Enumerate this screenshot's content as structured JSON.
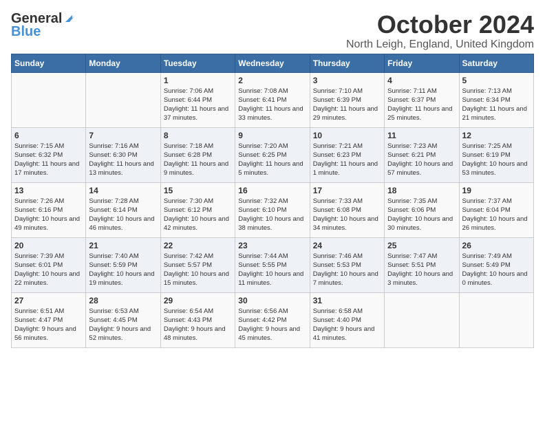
{
  "header": {
    "logo_general": "General",
    "logo_blue": "Blue",
    "month_title": "October 2024",
    "location": "North Leigh, England, United Kingdom"
  },
  "days_of_week": [
    "Sunday",
    "Monday",
    "Tuesday",
    "Wednesday",
    "Thursday",
    "Friday",
    "Saturday"
  ],
  "weeks": [
    [
      {
        "day": "",
        "detail": ""
      },
      {
        "day": "",
        "detail": ""
      },
      {
        "day": "1",
        "detail": "Sunrise: 7:06 AM\nSunset: 6:44 PM\nDaylight: 11 hours and 37 minutes."
      },
      {
        "day": "2",
        "detail": "Sunrise: 7:08 AM\nSunset: 6:41 PM\nDaylight: 11 hours and 33 minutes."
      },
      {
        "day": "3",
        "detail": "Sunrise: 7:10 AM\nSunset: 6:39 PM\nDaylight: 11 hours and 29 minutes."
      },
      {
        "day": "4",
        "detail": "Sunrise: 7:11 AM\nSunset: 6:37 PM\nDaylight: 11 hours and 25 minutes."
      },
      {
        "day": "5",
        "detail": "Sunrise: 7:13 AM\nSunset: 6:34 PM\nDaylight: 11 hours and 21 minutes."
      }
    ],
    [
      {
        "day": "6",
        "detail": "Sunrise: 7:15 AM\nSunset: 6:32 PM\nDaylight: 11 hours and 17 minutes."
      },
      {
        "day": "7",
        "detail": "Sunrise: 7:16 AM\nSunset: 6:30 PM\nDaylight: 11 hours and 13 minutes."
      },
      {
        "day": "8",
        "detail": "Sunrise: 7:18 AM\nSunset: 6:28 PM\nDaylight: 11 hours and 9 minutes."
      },
      {
        "day": "9",
        "detail": "Sunrise: 7:20 AM\nSunset: 6:25 PM\nDaylight: 11 hours and 5 minutes."
      },
      {
        "day": "10",
        "detail": "Sunrise: 7:21 AM\nSunset: 6:23 PM\nDaylight: 11 hours and 1 minute."
      },
      {
        "day": "11",
        "detail": "Sunrise: 7:23 AM\nSunset: 6:21 PM\nDaylight: 10 hours and 57 minutes."
      },
      {
        "day": "12",
        "detail": "Sunrise: 7:25 AM\nSunset: 6:19 PM\nDaylight: 10 hours and 53 minutes."
      }
    ],
    [
      {
        "day": "13",
        "detail": "Sunrise: 7:26 AM\nSunset: 6:16 PM\nDaylight: 10 hours and 49 minutes."
      },
      {
        "day": "14",
        "detail": "Sunrise: 7:28 AM\nSunset: 6:14 PM\nDaylight: 10 hours and 46 minutes."
      },
      {
        "day": "15",
        "detail": "Sunrise: 7:30 AM\nSunset: 6:12 PM\nDaylight: 10 hours and 42 minutes."
      },
      {
        "day": "16",
        "detail": "Sunrise: 7:32 AM\nSunset: 6:10 PM\nDaylight: 10 hours and 38 minutes."
      },
      {
        "day": "17",
        "detail": "Sunrise: 7:33 AM\nSunset: 6:08 PM\nDaylight: 10 hours and 34 minutes."
      },
      {
        "day": "18",
        "detail": "Sunrise: 7:35 AM\nSunset: 6:06 PM\nDaylight: 10 hours and 30 minutes."
      },
      {
        "day": "19",
        "detail": "Sunrise: 7:37 AM\nSunset: 6:04 PM\nDaylight: 10 hours and 26 minutes."
      }
    ],
    [
      {
        "day": "20",
        "detail": "Sunrise: 7:39 AM\nSunset: 6:01 PM\nDaylight: 10 hours and 22 minutes."
      },
      {
        "day": "21",
        "detail": "Sunrise: 7:40 AM\nSunset: 5:59 PM\nDaylight: 10 hours and 19 minutes."
      },
      {
        "day": "22",
        "detail": "Sunrise: 7:42 AM\nSunset: 5:57 PM\nDaylight: 10 hours and 15 minutes."
      },
      {
        "day": "23",
        "detail": "Sunrise: 7:44 AM\nSunset: 5:55 PM\nDaylight: 10 hours and 11 minutes."
      },
      {
        "day": "24",
        "detail": "Sunrise: 7:46 AM\nSunset: 5:53 PM\nDaylight: 10 hours and 7 minutes."
      },
      {
        "day": "25",
        "detail": "Sunrise: 7:47 AM\nSunset: 5:51 PM\nDaylight: 10 hours and 3 minutes."
      },
      {
        "day": "26",
        "detail": "Sunrise: 7:49 AM\nSunset: 5:49 PM\nDaylight: 10 hours and 0 minutes."
      }
    ],
    [
      {
        "day": "27",
        "detail": "Sunrise: 6:51 AM\nSunset: 4:47 PM\nDaylight: 9 hours and 56 minutes."
      },
      {
        "day": "28",
        "detail": "Sunrise: 6:53 AM\nSunset: 4:45 PM\nDaylight: 9 hours and 52 minutes."
      },
      {
        "day": "29",
        "detail": "Sunrise: 6:54 AM\nSunset: 4:43 PM\nDaylight: 9 hours and 48 minutes."
      },
      {
        "day": "30",
        "detail": "Sunrise: 6:56 AM\nSunset: 4:42 PM\nDaylight: 9 hours and 45 minutes."
      },
      {
        "day": "31",
        "detail": "Sunrise: 6:58 AM\nSunset: 4:40 PM\nDaylight: 9 hours and 41 minutes."
      },
      {
        "day": "",
        "detail": ""
      },
      {
        "day": "",
        "detail": ""
      }
    ]
  ]
}
